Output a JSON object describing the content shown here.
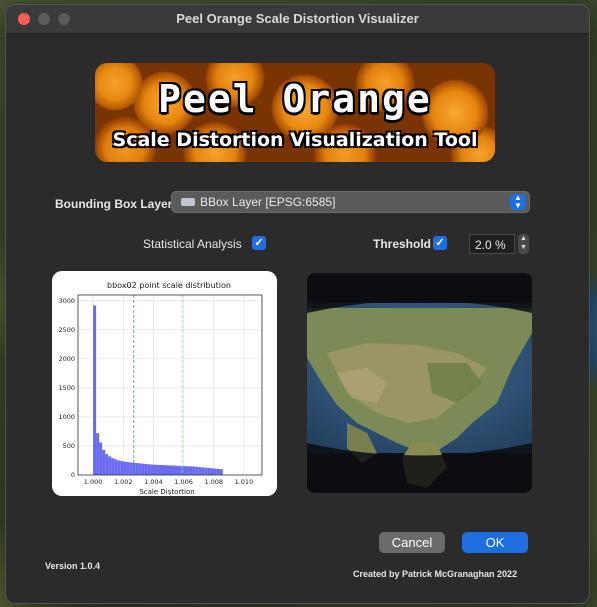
{
  "window": {
    "title": "Peel Orange Scale Distortion Visualizer"
  },
  "banner": {
    "title": "Peel Orange",
    "subtitle": "Scale Distortion Visualization Tool"
  },
  "form": {
    "bbox_label": "Bounding Box Layer",
    "bbox_value": "BBox Layer [EPSG:6585]",
    "stats_label": "Statistical Analysis",
    "stats_checked": true,
    "threshold_label": "Threshold",
    "threshold_checked": true,
    "threshold_value": "2.0 %"
  },
  "chart_data": {
    "type": "bar",
    "title": "bbox02 point scale distribution",
    "xlabel": "Scale Distortion",
    "ylabel": "",
    "xlim": [
      0.999,
      1.0112
    ],
    "ylim": [
      0,
      3100
    ],
    "xticks": [
      "1.000",
      "1.002",
      "1.004",
      "1.006",
      "1.008",
      "1.010"
    ],
    "yticks": [
      "0",
      "500",
      "1000",
      "1500",
      "2000",
      "2500",
      "3000"
    ],
    "bins_start": 1.0,
    "bin_width": 0.0002,
    "values": [
      2920,
      720,
      560,
      430,
      360,
      320,
      290,
      270,
      250,
      240,
      230,
      225,
      215,
      210,
      205,
      200,
      195,
      190,
      185,
      180,
      178,
      175,
      172,
      170,
      168,
      165,
      162,
      160,
      158,
      155,
      152,
      150,
      148,
      145,
      140,
      135,
      130,
      125,
      120,
      115,
      110,
      105,
      100
    ],
    "vlines": [
      1.0027,
      1.0059
    ],
    "grid": true,
    "bar_color": "#6a6af5"
  },
  "buttons": {
    "cancel": "Cancel",
    "ok": "OK"
  },
  "footer": {
    "version": "Version 1.0.4",
    "credit": "Created by Patrick McGranaghan 2022"
  }
}
